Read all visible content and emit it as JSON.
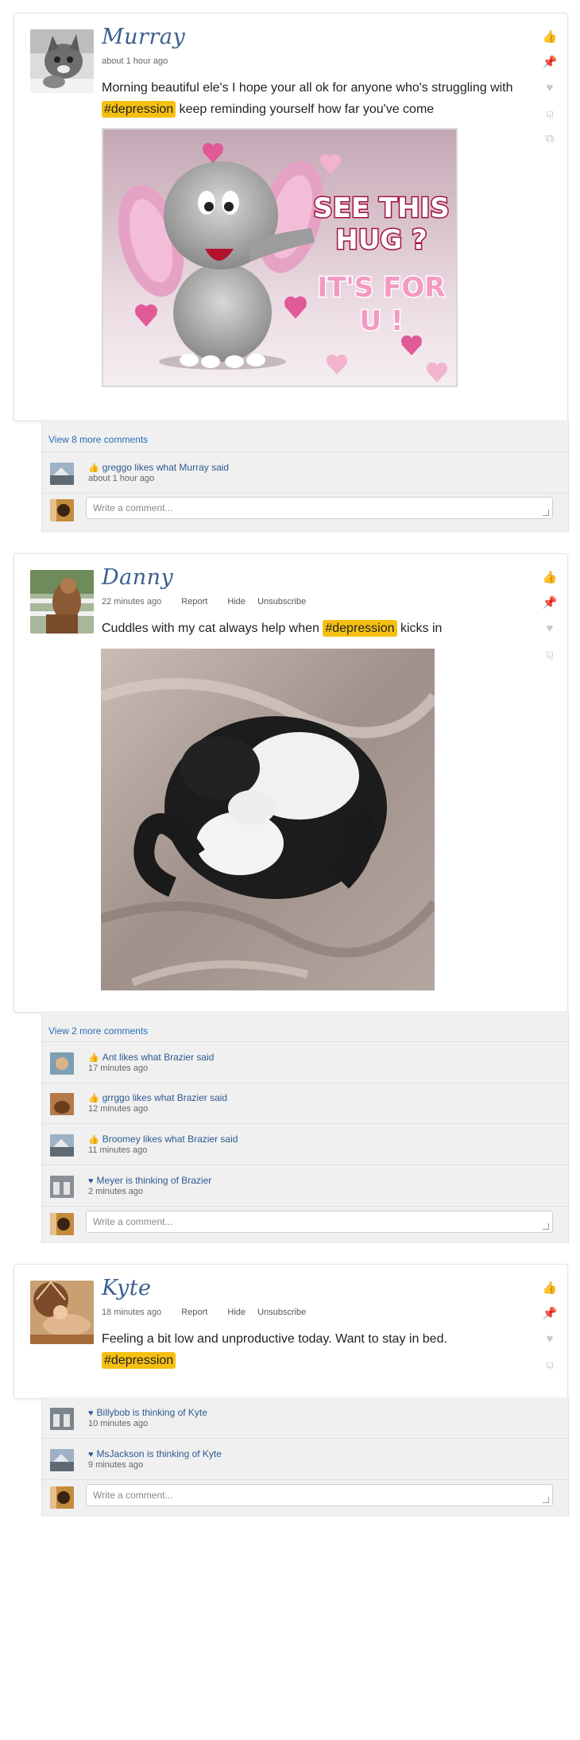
{
  "posts": [
    {
      "author": "Murray",
      "time": "about 1 hour ago",
      "text_before": "Morning beautiful ele's I hope your all ok for anyone who's struggling with",
      "tag": "#depression",
      "text_after": "keep reminding yourself how far you've come",
      "image": {
        "caption_lines": [
          "SEE THIS",
          "HUG ?",
          "IT'S FOR",
          "U !"
        ]
      },
      "view_more": "View 8 more comments",
      "comments": [
        {
          "text": "greggo likes what Murray said",
          "icon": "thumbs-up-icon",
          "time": "about 1 hour ago"
        }
      ],
      "input_placeholder": "Write a comment..."
    },
    {
      "author": "Danny",
      "time": "22 minutes ago",
      "actions": [
        "Report",
        "Hide",
        "Unsubscribe"
      ],
      "text_before": "Cuddles with my cat always help when",
      "tag": "#depression",
      "text_after": "kicks in",
      "view_more": "View 2 more comments",
      "comments": [
        {
          "text": "Ant likes what Brazier said",
          "icon": "thumbs-up-icon",
          "time": "17 minutes ago"
        },
        {
          "text": "grrggo likes what Brazier said",
          "icon": "thumbs-up-icon",
          "time": "12 minutes ago"
        },
        {
          "text": "Broomey likes what Brazier said",
          "icon": "thumbs-up-icon",
          "time": "11 minutes ago"
        },
        {
          "text": "Meyer is thinking of Brazier",
          "icon": "heart-icon",
          "time": "2 minutes ago"
        }
      ],
      "input_placeholder": "Write a comment..."
    },
    {
      "author": "Kyte",
      "time": "18 minutes ago",
      "actions": [
        "Report",
        "Hide",
        "Unsubscribe"
      ],
      "text_before": "Feeling a bit low and unproductive today. Want to stay in bed.",
      "tag": "#depression",
      "comments": [
        {
          "text": "Billybob is thinking of Kyte",
          "icon": "heart-icon",
          "time": "10 minutes ago"
        },
        {
          "text": "MsJackson is thinking of Kyte",
          "icon": "heart-icon",
          "time": "9 minutes ago"
        }
      ],
      "input_placeholder": "Write a comment..."
    }
  ],
  "colors": {
    "tag": "#f5c012",
    "author": "#3b5f8f",
    "link": "#2a6db6"
  }
}
